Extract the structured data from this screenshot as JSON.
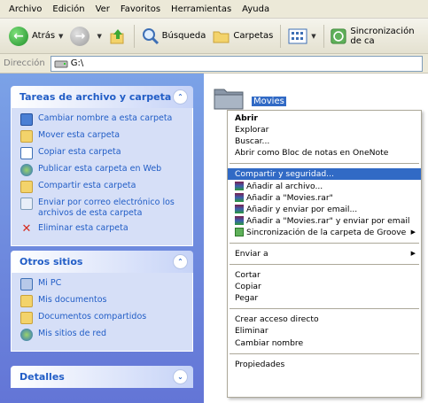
{
  "menubar": [
    "Archivo",
    "Edición",
    "Ver",
    "Favoritos",
    "Herramientas",
    "Ayuda"
  ],
  "toolbar": {
    "back_label": "Atrás",
    "search_label": "Búsqueda",
    "folders_label": "Carpetas",
    "groove_label": "Sincronización de ca"
  },
  "address": {
    "label": "Dirección",
    "value": "G:\\"
  },
  "tasks_panel": {
    "title": "Tareas de archivo y carpeta",
    "items": [
      "Cambiar nombre a esta carpeta",
      "Mover esta carpeta",
      "Copiar esta carpeta",
      "Publicar esta carpeta en Web",
      "Compartir esta carpeta",
      "Enviar por correo electrónico los archivos de esta carpeta",
      "Eliminar esta carpeta"
    ]
  },
  "other_panel": {
    "title": "Otros sitios",
    "items": [
      "Mi PC",
      "Mis documentos",
      "Documentos compartidos",
      "Mis sitios de red"
    ]
  },
  "details_panel": {
    "title": "Detalles"
  },
  "folder": {
    "name": "Movies"
  },
  "context_menu": {
    "g1": [
      "Abrir",
      "Explorar",
      "Buscar...",
      "Abrir como Bloc de notas en OneNote"
    ],
    "g2": [
      "Compartir y seguridad...",
      "Añadir al archivo...",
      "Añadir a \"Movies.rar\"",
      "Añadir y enviar por email...",
      "Añadir a \"Movies.rar\" y enviar por email",
      "Sincronización de la carpeta de Groove"
    ],
    "g3": [
      "Enviar a"
    ],
    "g4": [
      "Cortar",
      "Copiar",
      "Pegar"
    ],
    "g5": [
      "Crear acceso directo",
      "Eliminar",
      "Cambiar nombre"
    ],
    "g6": [
      "Propiedades"
    ]
  },
  "colors": {
    "xp_blue_link": "#215dc6",
    "selection": "#316ac5",
    "pane_gradient_top": "#7ba2e7"
  }
}
